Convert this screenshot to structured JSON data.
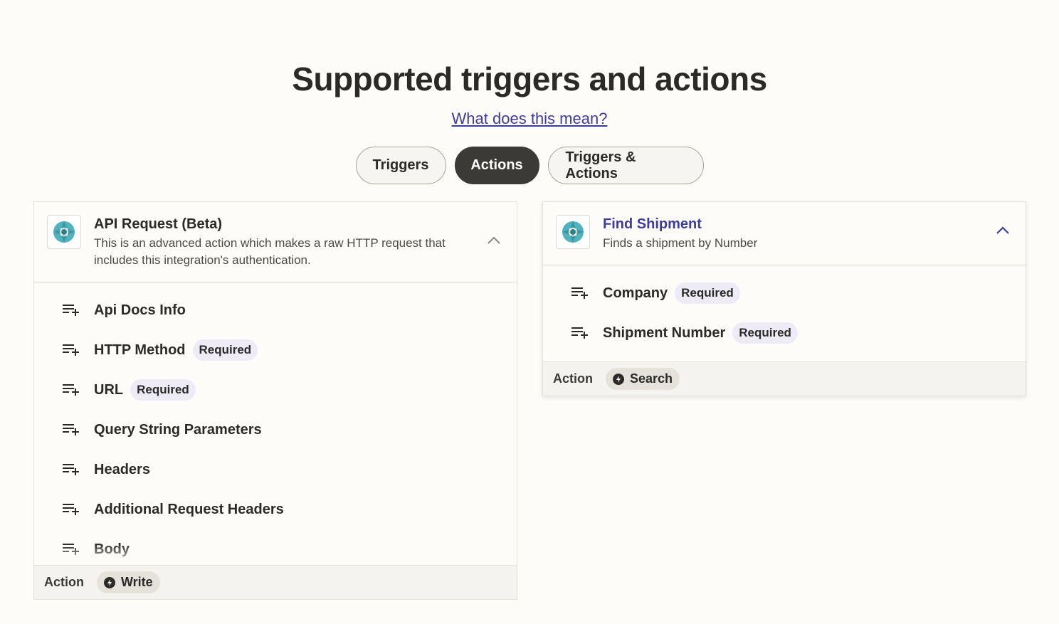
{
  "header": {
    "title": "Supported triggers and actions",
    "help_link": "What does this mean?"
  },
  "tabs": [
    {
      "label": "Triggers",
      "active": false
    },
    {
      "label": "Actions",
      "active": true
    },
    {
      "label": "Triggers & Actions",
      "active": false
    }
  ],
  "cards": [
    {
      "title": "API Request (Beta)",
      "description": "This is an advanced action which makes a raw HTTP request that includes this integration's authentication.",
      "fields": [
        {
          "label": "Api Docs Info",
          "badge": ""
        },
        {
          "label": "HTTP Method",
          "badge": "Required"
        },
        {
          "label": "URL",
          "badge": "Required"
        },
        {
          "label": "Query String Parameters",
          "badge": ""
        },
        {
          "label": "Headers",
          "badge": ""
        },
        {
          "label": "Additional Request Headers",
          "badge": ""
        },
        {
          "label": "Body",
          "badge": ""
        }
      ],
      "footer_label": "Action",
      "footer_type": "Write"
    },
    {
      "title": "Find Shipment",
      "description": "Finds a shipment by Number",
      "fields": [
        {
          "label": "Company",
          "badge": "Required"
        },
        {
          "label": "Shipment Number",
          "badge": "Required"
        }
      ],
      "footer_label": "Action",
      "footer_type": "Search"
    }
  ],
  "colors": {
    "background": "#fdfcf9",
    "link": "#3d3c9d",
    "active_tab": "#3b3a36",
    "badge_bg": "#ecebf6",
    "logo_teal": "#4fb3bf"
  },
  "icons": {
    "app_logo": "lifebuoy-logo-icon",
    "field": "playlist-add-icon",
    "collapse": "chevron-up-icon",
    "action_type": "bolt-icon"
  }
}
